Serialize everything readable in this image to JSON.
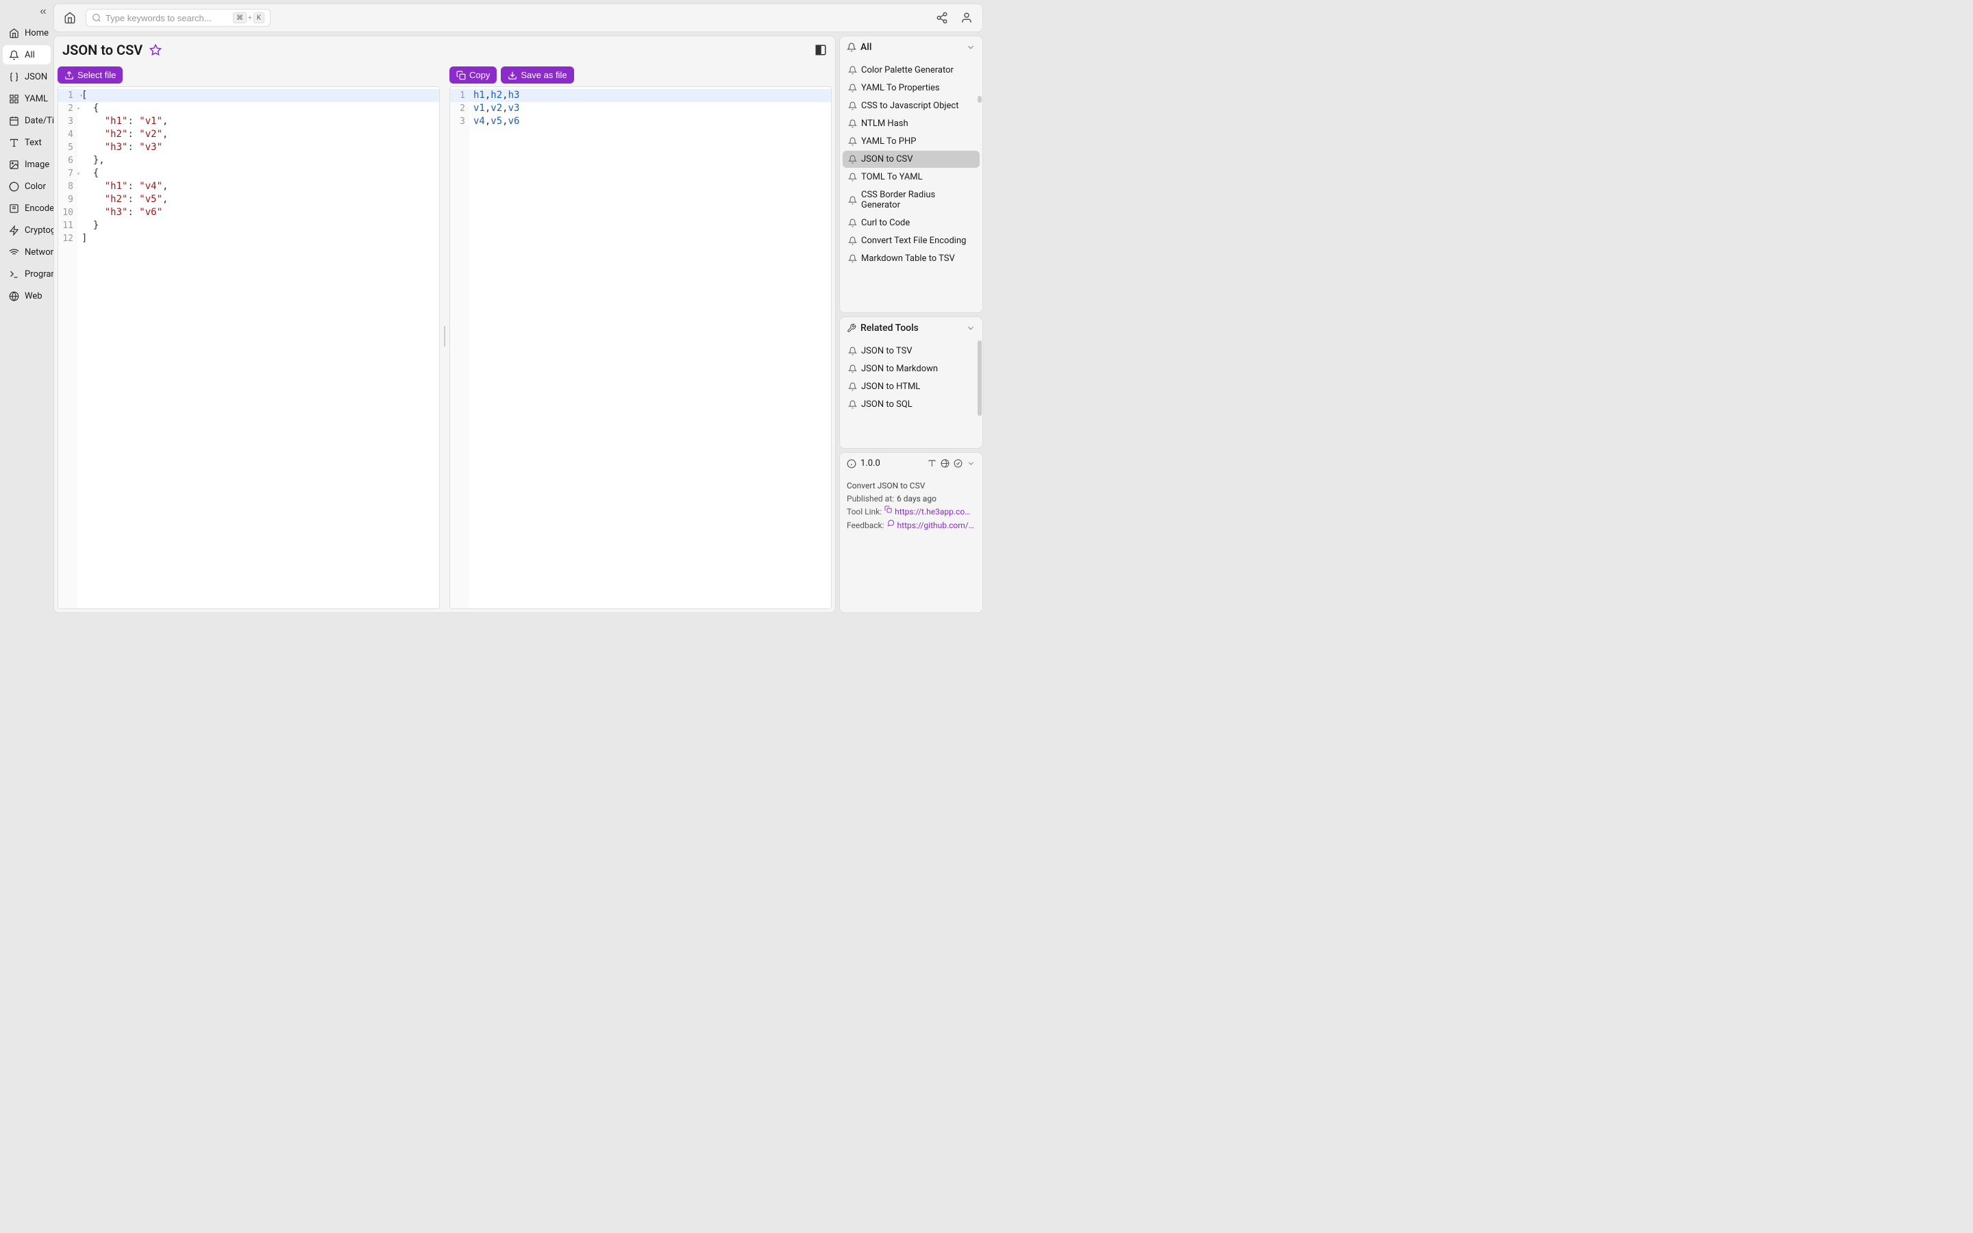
{
  "sidebar": {
    "items": [
      {
        "label": "Home"
      },
      {
        "label": "All"
      },
      {
        "label": "JSON"
      },
      {
        "label": "YAML"
      },
      {
        "label": "Date/Time"
      },
      {
        "label": "Text"
      },
      {
        "label": "Image"
      },
      {
        "label": "Color"
      },
      {
        "label": "Encode"
      },
      {
        "label": "Cryptography"
      },
      {
        "label": "Network"
      },
      {
        "label": "Programming"
      },
      {
        "label": "Web"
      }
    ]
  },
  "search": {
    "placeholder": "Type keywords to search...",
    "kbd1": "⌘",
    "plus": "+",
    "kbd2": "K"
  },
  "page": {
    "title": "JSON to CSV"
  },
  "left_editor": {
    "buttons": {
      "select_file": "Select file"
    },
    "lines": [
      "[",
      "  {",
      "    \"h1\": \"v1\",",
      "    \"h2\": \"v2\",",
      "    \"h3\": \"v3\"",
      "  },",
      "  {",
      "    \"h1\": \"v4\",",
      "    \"h2\": \"v5\",",
      "    \"h3\": \"v6\"",
      "  }",
      "]"
    ]
  },
  "right_editor": {
    "buttons": {
      "copy": "Copy",
      "save": "Save as file"
    },
    "lines": [
      "h1,h2,h3",
      "v1,v2,v3",
      "v4,v5,v6"
    ]
  },
  "all_section": {
    "title": "All",
    "items": [
      "Color Palette Generator",
      "YAML To Properties",
      "CSS to Javascript Object",
      "NTLM Hash",
      "YAML To PHP",
      "JSON to CSV",
      "TOML To YAML",
      "CSS Border Radius Generator",
      "Curl to Code",
      "Convert Text File Encoding",
      "Markdown Table to TSV"
    ],
    "active_index": 5
  },
  "related_section": {
    "title": "Related Tools",
    "items": [
      "JSON to TSV",
      "JSON to Markdown",
      "JSON to HTML",
      "JSON to SQL"
    ]
  },
  "info": {
    "version": "1.0.0",
    "description": "Convert JSON to CSV",
    "published_label": "Published at:",
    "published_value": "6 days ago",
    "tool_link_label": "Tool Link:",
    "tool_link_value": "https://t.he3app.co…",
    "feedback_label": "Feedback:",
    "feedback_value": "https://github.com/…"
  }
}
